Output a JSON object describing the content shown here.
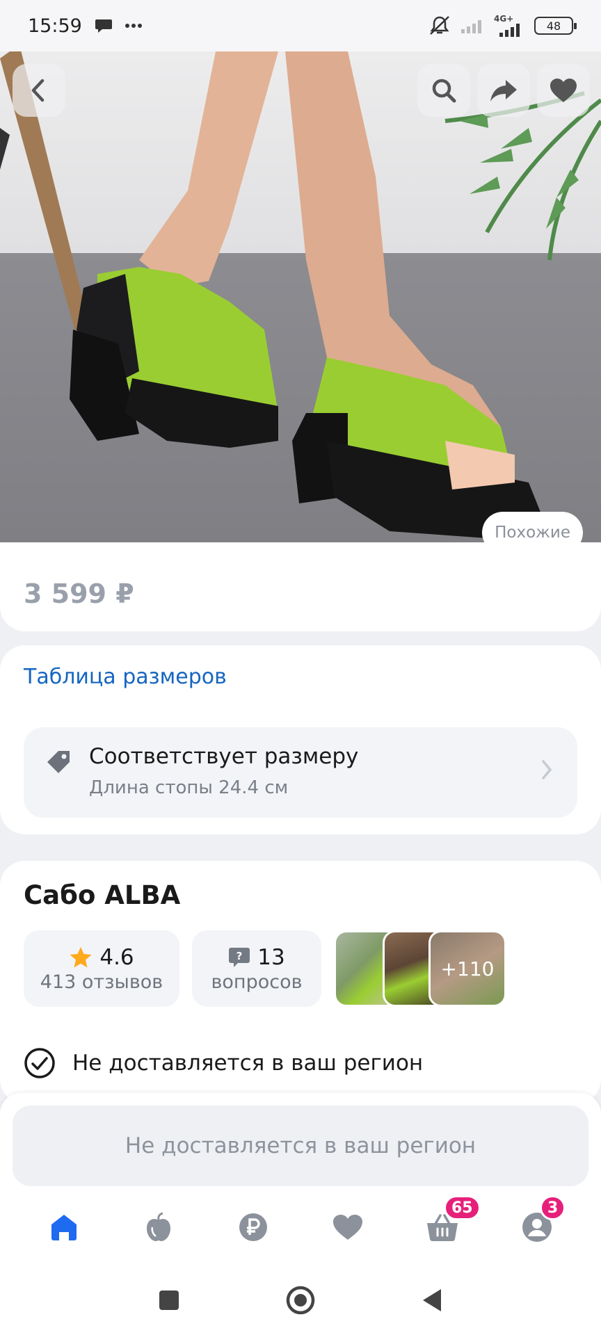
{
  "status_bar": {
    "time": "15:59",
    "network": "4G+",
    "battery": "48"
  },
  "hero": {
    "similar_label": "Похожие"
  },
  "price": {
    "value": "3 599 ₽"
  },
  "size": {
    "table_link": "Таблица размеров",
    "fit_title": "Соответствует размеру",
    "fit_subtitle": "Длина стопы 24.4 см"
  },
  "product": {
    "title": "Сабо ALBA",
    "rating": "4.6",
    "reviews": "413 отзывов",
    "questions_count": "13",
    "questions_label": "вопросов",
    "more_photos": "+110",
    "delivery_status": "Не доставляется в ваш регион"
  },
  "action": {
    "label": "Не доставляется в ваш регион"
  },
  "bottom_nav": {
    "items": [
      {
        "icon": "home-icon",
        "active": true
      },
      {
        "icon": "apple-icon"
      },
      {
        "icon": "ruble-icon"
      },
      {
        "icon": "heart-icon"
      },
      {
        "icon": "basket-icon",
        "badge": "65"
      },
      {
        "icon": "profile-icon",
        "badge": "3"
      }
    ]
  },
  "colors": {
    "accent": "#1565c0",
    "nav_active": "#1e6bf0",
    "badge": "#e6207a",
    "shoe_green": "#9acd32"
  }
}
